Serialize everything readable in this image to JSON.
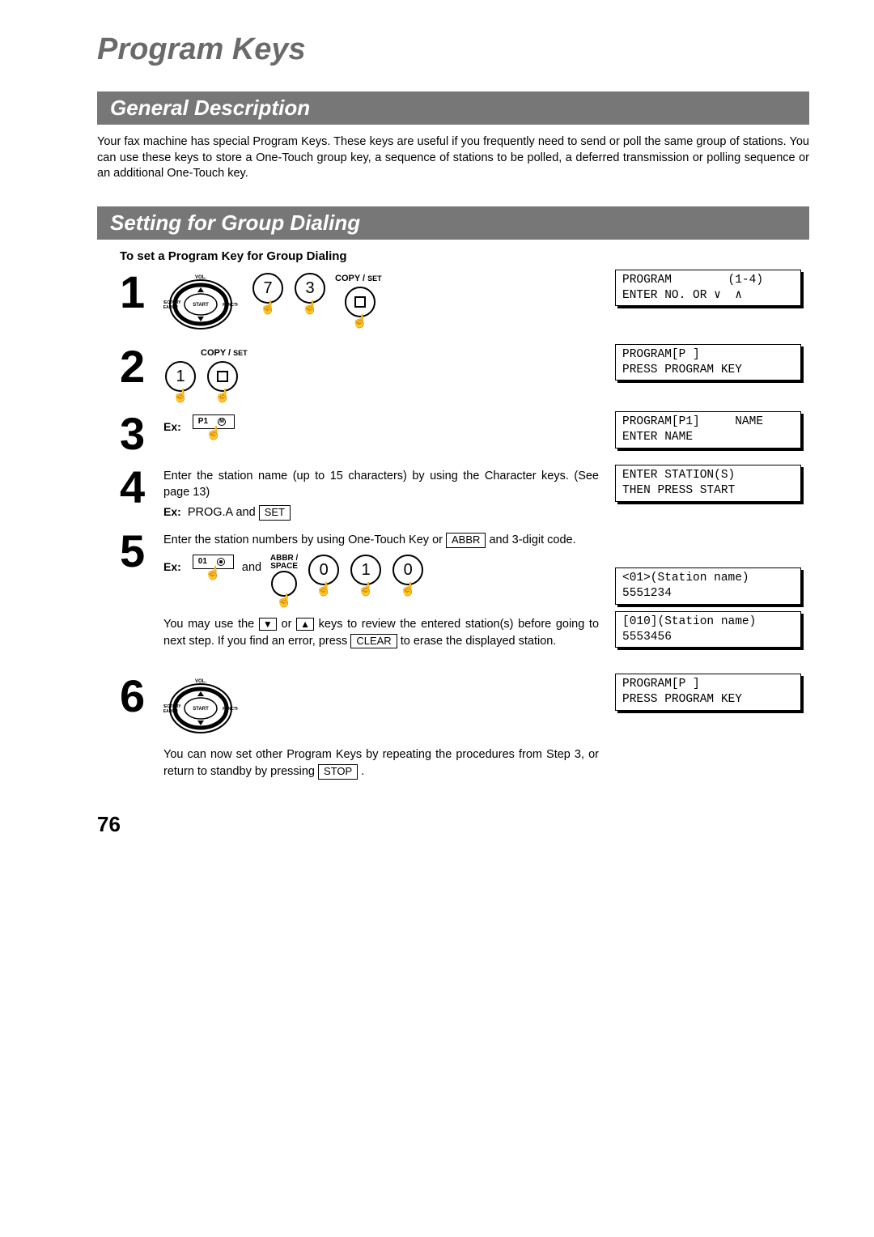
{
  "title": "Program Keys",
  "sections": {
    "general": {
      "heading": "General Description",
      "body": "Your fax machine has special Program Keys.  These keys are useful if you frequently need to send or poll the same group of stations.  You can use these keys to store a One-Touch group key, a sequence of stations to be polled, a deferred transmission or polling sequence or an additional One-Touch key."
    },
    "group_dial": {
      "heading": "Setting for Group Dialing",
      "subheading": "To set a Program Key for Group Dialing"
    }
  },
  "labels": {
    "copy": "COPY",
    "set": "SET",
    "ex": "Ex:",
    "abbr": "ABBR",
    "space": "SPACE",
    "and": "and",
    "vol": "VOL.",
    "directory": "DIRECTORY\nSEARCH",
    "function": "FUNCTION",
    "start": "START"
  },
  "keys": {
    "seven": "7",
    "three": "3",
    "one": "1",
    "zero": "0",
    "p1": "P1",
    "m": "M",
    "ot01": "01",
    "set_btn": "SET",
    "abbr_btn": "ABBR",
    "clear_btn": "CLEAR",
    "stop_btn": "STOP"
  },
  "steps": {
    "s1": {
      "num": "1"
    },
    "s2": {
      "num": "2"
    },
    "s3": {
      "num": "3"
    },
    "s4": {
      "num": "4",
      "text_a": "Enter the station name (up to 15 characters) by using the Character keys.  (See page 13)",
      "ex": " PROG.A and"
    },
    "s5": {
      "num": "5",
      "text_a": "Enter the station numbers by using One-Touch Key or ",
      "text_b": " and 3-digit code.",
      "text_c": "You may use the ",
      "text_d": " or ",
      "text_e": " keys to review the entered station(s) before going to next step. If you find an error, press ",
      "text_f": " to erase the displayed station."
    },
    "s6": {
      "num": "6",
      "text_a": "You can now set other Program Keys by repeating the procedures from Step 3, or return to standby by pressing ",
      "text_b": " ."
    }
  },
  "lcd": {
    "l1a": "PROGRAM        (1-4)",
    "l1b": "ENTER NO. OR ∨  ∧",
    "l2a": "PROGRAM[P ]",
    "l2b": "PRESS PROGRAM KEY",
    "l3a": "PROGRAM[P1]     NAME",
    "l3b": "ENTER NAME",
    "l4a": "ENTER STATION(S)",
    "l4b": "THEN PRESS START",
    "l5a": "<01>(Station name)",
    "l5b": "5551234",
    "l5c": "[010](Station name)",
    "l5d": "5553456",
    "l6a": "PROGRAM[P ]",
    "l6b": "PRESS PROGRAM KEY"
  },
  "page_number": "76"
}
